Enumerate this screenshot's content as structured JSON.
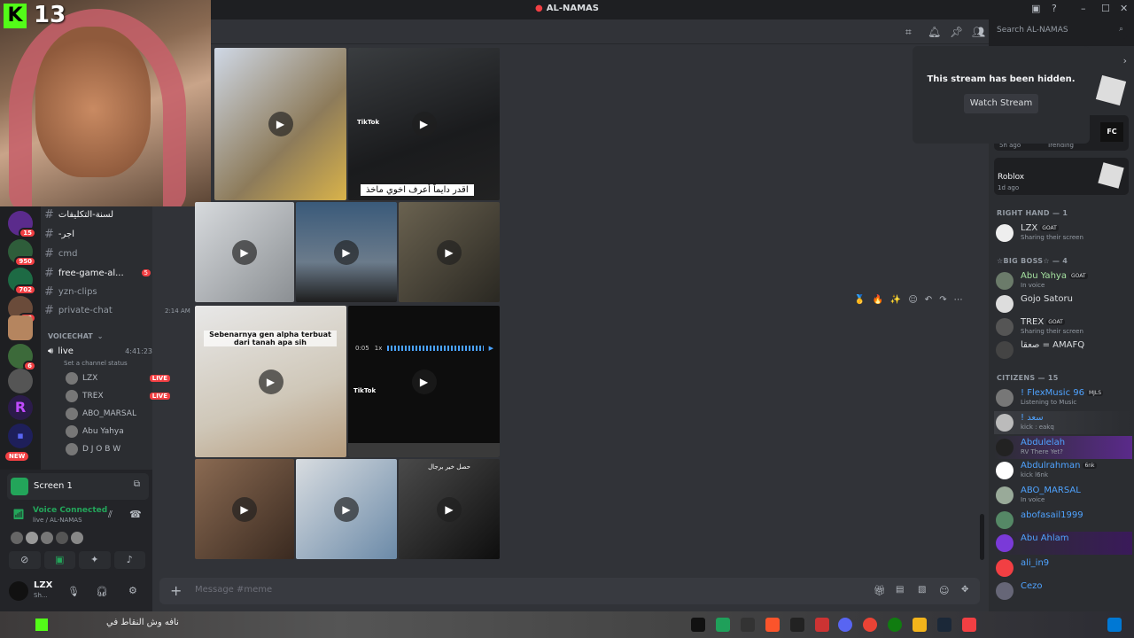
{
  "window": {
    "title": "AL-NAMAS"
  },
  "webcam": {
    "counter": "13"
  },
  "header": {
    "search_placeholder": "Search AL-NAMAS"
  },
  "channels": [
    {
      "label": "لسنة-التكليفات",
      "unread": true
    },
    {
      "label": "-اجر",
      "unread": true
    },
    {
      "label": "cmd",
      "unread": false
    },
    {
      "label": "free-game-al...",
      "unread": true,
      "count": "5"
    },
    {
      "label": "yzn-clips",
      "unread": false
    },
    {
      "label": "private-chat",
      "unread": false
    }
  ],
  "voice": {
    "category": "VOICECHAT",
    "channel": "live",
    "timer": "4:41:23",
    "status_prompt": "Set a channel status",
    "users": [
      {
        "name": "LZX",
        "live": true
      },
      {
        "name": "TREX",
        "live": true
      },
      {
        "name": "ABO_MARSAL",
        "live": false
      },
      {
        "name": "Abu Yahya",
        "live": false
      },
      {
        "name": "D J O B W",
        "live": false
      }
    ],
    "live_label": "LIVE"
  },
  "rail_badges": [
    "15",
    "950",
    "702",
    "43",
    "6"
  ],
  "rail_new": "NEW",
  "panel": {
    "screen_label": "Screen 1",
    "voice_connected": "Voice Connected",
    "voice_path": "live / AL-NAMAS",
    "user_name": "LZX",
    "user_status": "Sh..."
  },
  "messages": {
    "timestamp": "2:14 AM",
    "caption_arabic": "اقدر دايماً أعرف اخوي ماخذ",
    "tiktok_label": "TikTok",
    "indo_caption": "Sebenarnya gen alpha terbuat dari tanah apa sih",
    "voice_time": "0:05",
    "voice_speed": "1x",
    "caption_bottom_right": "حصل خير برجال"
  },
  "composer": {
    "placeholder": "Message #meme"
  },
  "stream_hidden": {
    "text": "This stream has been hidden.",
    "button": "Watch Stream"
  },
  "members": {
    "activity_cards": [
      {
        "time": "5h ago",
        "tag": "Trending"
      },
      {
        "name": "Roblox",
        "time": "1d ago"
      }
    ],
    "categories": [
      {
        "label": "RIGHT HAND — 1"
      },
      {
        "label": "☆BIG BOSS☆ — 4"
      },
      {
        "label": "CITIZENS — 15"
      }
    ],
    "right_hand": [
      {
        "name": "LZX",
        "tag": "GOAT",
        "status": "Sharing their screen"
      }
    ],
    "big_boss": [
      {
        "name": "Abu Yahya",
        "tag": "GOAT",
        "status": "In voice"
      },
      {
        "name": "Gojo Satoru",
        "tag": "",
        "status": ""
      },
      {
        "name": "TREX",
        "tag": "GOAT",
        "status": "Sharing their screen"
      },
      {
        "name": "صعقا = AMAFQ",
        "tag": "",
        "status": ""
      }
    ],
    "citizens": [
      {
        "name": "! FlexMusic 96",
        "tag": "MJLS",
        "status": "Listening to Music"
      },
      {
        "name": "! سعد",
        "tag": "",
        "status": "kick : eakq"
      },
      {
        "name": "Abdulelah",
        "tag": "",
        "status": "RV There Yet?"
      },
      {
        "name": "Abdulrahman",
        "tag": "6nk",
        "status": "kick l6nk"
      },
      {
        "name": "ABO_MARSAL",
        "tag": "",
        "status": "In voice"
      },
      {
        "name": "abofasail1999",
        "tag": "",
        "status": ""
      },
      {
        "name": "Abu Ahlam",
        "tag": "",
        "status": ""
      },
      {
        "name": "ali_in9",
        "tag": "",
        "status": ""
      },
      {
        "name": "Cezo",
        "tag": "",
        "status": ""
      }
    ]
  },
  "taskbar": {
    "marquee": "نافه وش النقاط في"
  },
  "colors": {
    "accent": "#5865f2",
    "live": "#f23f43",
    "online": "#23a55a",
    "kick": "#53fc18"
  }
}
